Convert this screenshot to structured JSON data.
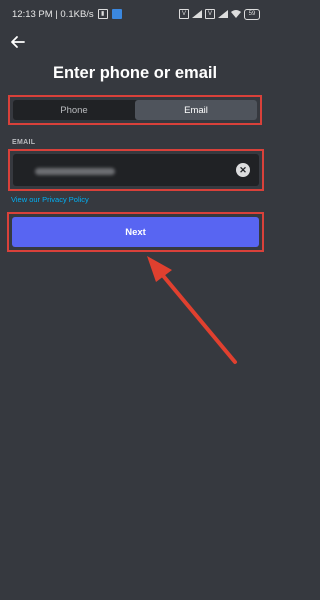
{
  "status": {
    "time_and_speed": "12:13 PM | 0.1KB/s",
    "battery": "59"
  },
  "header": {
    "title": "Enter phone or email"
  },
  "tabs": [
    {
      "label": "Phone",
      "active": false
    },
    {
      "label": "Email",
      "active": true
    }
  ],
  "email": {
    "label": "EMAIL",
    "value": ""
  },
  "links": {
    "privacy": "View our Privacy Policy"
  },
  "actions": {
    "next": "Next"
  },
  "colors": {
    "background": "#36393f",
    "accent": "#5865f2",
    "highlight": "#d9413a",
    "link": "#00b0f4"
  }
}
